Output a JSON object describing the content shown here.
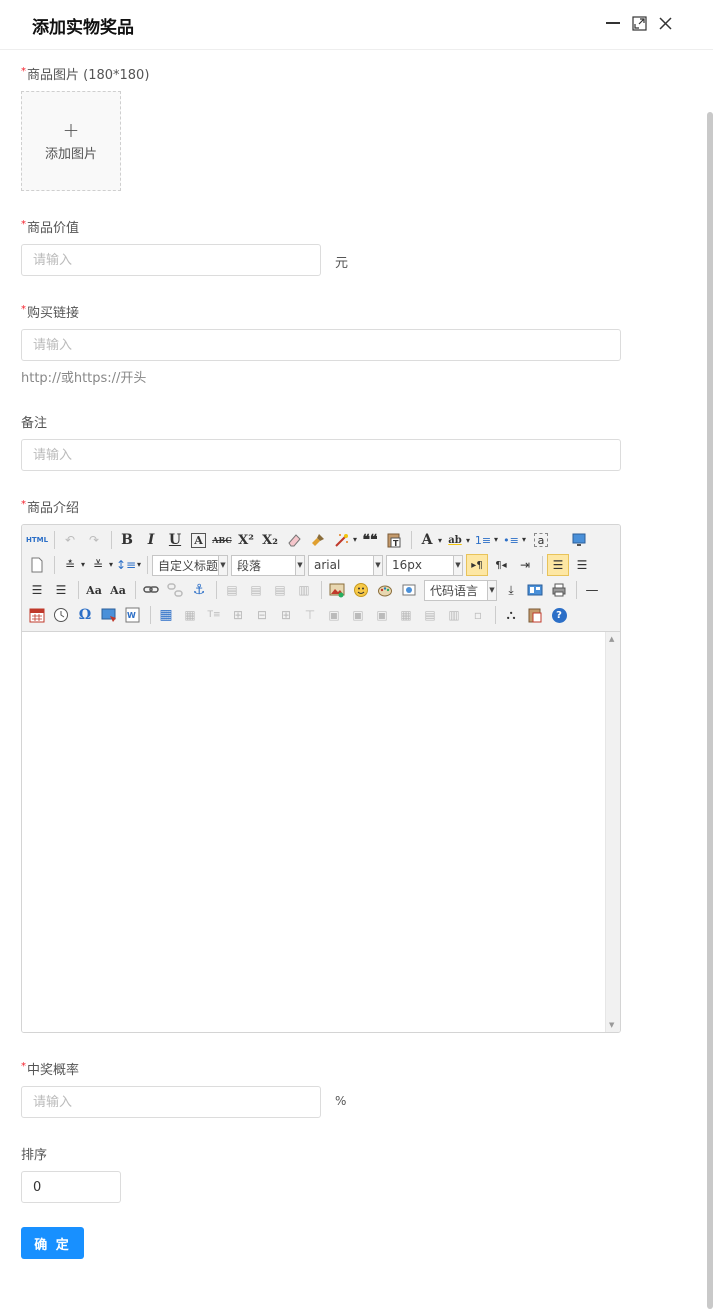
{
  "dialog": {
    "title": "添加实物奖品",
    "minimize_icon": "minimize-icon",
    "maximize_icon": "maximize-icon",
    "close_icon": "close-icon"
  },
  "form": {
    "image": {
      "label": "商品图片 (180*180)",
      "required": true,
      "upload_plus": "+",
      "upload_text": "添加图片"
    },
    "price": {
      "label": "商品价值",
      "required": true,
      "placeholder": "请输入",
      "value": "",
      "unit": "元"
    },
    "link": {
      "label": "购买链接",
      "required": true,
      "placeholder": "请输入",
      "value": "",
      "hint": "http://或https://开头"
    },
    "remark": {
      "label": "备注",
      "required": false,
      "placeholder": "请输入",
      "value": ""
    },
    "intro": {
      "label": "商品介绍",
      "required": true
    },
    "probability": {
      "label": "中奖概率",
      "required": true,
      "placeholder": "请输入",
      "value": "",
      "unit": "%"
    },
    "sort": {
      "label": "排序",
      "required": false,
      "value": "0"
    },
    "submit_label": "确 定"
  },
  "editor": {
    "combos": {
      "custom_heading": "自定义标题",
      "paragraph": "段落",
      "font_family": "arial",
      "font_size": "16px",
      "code_language": "代码语言"
    },
    "toolbar_row1": {
      "html": "HTML",
      "bold": "B",
      "italic": "I",
      "underline": "U",
      "font_border": "A",
      "strike": "ABC",
      "superscript": "X²",
      "subscript": "X₂",
      "blockquote": "❝❝",
      "forecolor": "A",
      "backcolor": "ab",
      "insertorderedlist": "1≡",
      "insertunorderedlist": "•≡",
      "selectall": "a"
    },
    "toolbar_row3": {
      "autotypeset": "Aa",
      "special_chars": "Ω"
    },
    "toolbar_row4": {
      "help": "?"
    }
  },
  "colors": {
    "primary": "#1890ff",
    "required": "#f5222d",
    "active_tool": "#fde7a4"
  }
}
